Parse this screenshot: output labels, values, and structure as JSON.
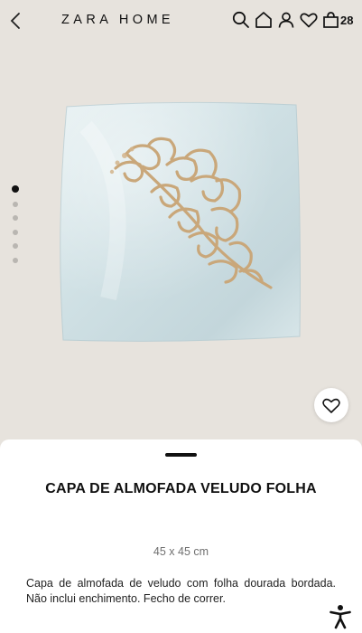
{
  "header": {
    "logo": "ZARA HOME",
    "cart_count": "28",
    "icons": [
      "back-icon",
      "search-icon",
      "home-icon",
      "user-icon",
      "heart-icon",
      "bag-icon"
    ]
  },
  "gallery": {
    "image": "velvet cushion cover with gold embroidered leaf",
    "dot_count": 6,
    "active_index": 0
  },
  "product": {
    "title": "CAPA DE ALMOFADA VELUDO FOLHA",
    "size": "45 x 45 cm",
    "description": "Capa de almofada de veludo com folha dourada bordada. Não inclui enchimento. Fecho de correr."
  },
  "colors": {
    "background": "#e7e3dd",
    "cushion": "#cfe0e3",
    "gold": "#c9a77a"
  }
}
